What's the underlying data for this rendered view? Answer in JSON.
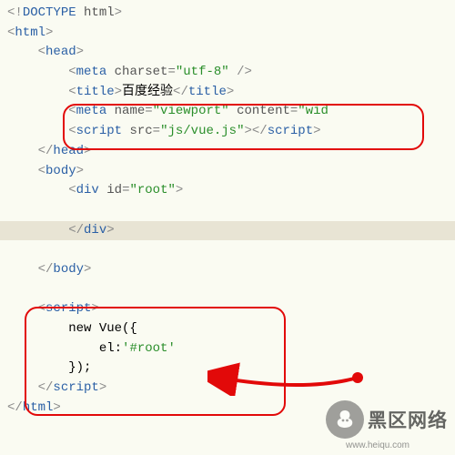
{
  "code": {
    "lines": [
      {
        "indent": 0,
        "tokens": [
          {
            "t": "punct",
            "v": "<!"
          },
          {
            "t": "tag",
            "v": "DOCTYPE"
          },
          {
            "t": "attr",
            "v": " html"
          },
          {
            "t": "punct",
            "v": ">"
          }
        ]
      },
      {
        "indent": 0,
        "tokens": [
          {
            "t": "punct",
            "v": "<"
          },
          {
            "t": "tag",
            "v": "html"
          },
          {
            "t": "punct",
            "v": ">"
          }
        ]
      },
      {
        "indent": 1,
        "tokens": [
          {
            "t": "punct",
            "v": "<"
          },
          {
            "t": "tag",
            "v": "head"
          },
          {
            "t": "punct",
            "v": ">"
          }
        ]
      },
      {
        "indent": 2,
        "tokens": [
          {
            "t": "punct",
            "v": "<"
          },
          {
            "t": "tag",
            "v": "meta"
          },
          {
            "t": "attr",
            "v": " charset"
          },
          {
            "t": "equals",
            "v": "="
          },
          {
            "t": "value",
            "v": "\"utf-8\""
          },
          {
            "t": "punct",
            "v": " />"
          }
        ]
      },
      {
        "indent": 2,
        "tokens": [
          {
            "t": "punct",
            "v": "<"
          },
          {
            "t": "tag",
            "v": "title"
          },
          {
            "t": "punct",
            "v": ">"
          },
          {
            "t": "text-content",
            "v": "百度经验"
          },
          {
            "t": "punct",
            "v": "</"
          },
          {
            "t": "tag",
            "v": "title"
          },
          {
            "t": "punct",
            "v": ">"
          }
        ]
      },
      {
        "indent": 2,
        "tokens": [
          {
            "t": "punct",
            "v": "<"
          },
          {
            "t": "tag",
            "v": "meta"
          },
          {
            "t": "attr",
            "v": " name"
          },
          {
            "t": "equals",
            "v": "="
          },
          {
            "t": "value",
            "v": "\"viewport\""
          },
          {
            "t": "attr",
            "v": " content"
          },
          {
            "t": "equals",
            "v": "="
          },
          {
            "t": "value",
            "v": "\"wid"
          }
        ]
      },
      {
        "indent": 2,
        "tokens": [
          {
            "t": "punct",
            "v": "<"
          },
          {
            "t": "tag",
            "v": "script"
          },
          {
            "t": "attr",
            "v": " src"
          },
          {
            "t": "equals",
            "v": "="
          },
          {
            "t": "value",
            "v": "\"js/vue.js\""
          },
          {
            "t": "punct",
            "v": "></"
          },
          {
            "t": "tag",
            "v": "script"
          },
          {
            "t": "punct",
            "v": ">"
          }
        ]
      },
      {
        "indent": 1,
        "tokens": [
          {
            "t": "punct",
            "v": "</"
          },
          {
            "t": "tag",
            "v": "head"
          },
          {
            "t": "punct",
            "v": ">"
          }
        ]
      },
      {
        "indent": 1,
        "tokens": [
          {
            "t": "punct",
            "v": "<"
          },
          {
            "t": "tag",
            "v": "body"
          },
          {
            "t": "punct",
            "v": ">"
          }
        ]
      },
      {
        "indent": 2,
        "tokens": [
          {
            "t": "punct",
            "v": "<"
          },
          {
            "t": "tag",
            "v": "div"
          },
          {
            "t": "attr",
            "v": " id"
          },
          {
            "t": "equals",
            "v": "="
          },
          {
            "t": "value",
            "v": "\"root\""
          },
          {
            "t": "punct",
            "v": ">"
          }
        ]
      },
      {
        "indent": 0,
        "tokens": []
      },
      {
        "indent": 2,
        "highlight": true,
        "tokens": [
          {
            "t": "punct",
            "v": "</"
          },
          {
            "t": "tag",
            "v": "div"
          },
          {
            "t": "punct",
            "v": ">"
          }
        ]
      },
      {
        "indent": 0,
        "tokens": []
      },
      {
        "indent": 1,
        "tokens": [
          {
            "t": "punct",
            "v": "</"
          },
          {
            "t": "tag",
            "v": "body"
          },
          {
            "t": "punct",
            "v": ">"
          }
        ]
      },
      {
        "indent": 0,
        "tokens": []
      },
      {
        "indent": 1,
        "tokens": [
          {
            "t": "punct",
            "v": "<"
          },
          {
            "t": "tag",
            "v": "script"
          },
          {
            "t": "punct",
            "v": ">"
          }
        ]
      },
      {
        "indent": 2,
        "tokens": [
          {
            "t": "text-content",
            "v": "new Vue({"
          }
        ]
      },
      {
        "indent": 3,
        "tokens": [
          {
            "t": "text-content",
            "v": "el:"
          },
          {
            "t": "value",
            "v": "'#root'"
          }
        ]
      },
      {
        "indent": 2,
        "tokens": [
          {
            "t": "text-content",
            "v": "});"
          }
        ]
      },
      {
        "indent": 1,
        "tokens": [
          {
            "t": "punct",
            "v": "</"
          },
          {
            "t": "tag",
            "v": "script"
          },
          {
            "t": "punct",
            "v": ">"
          }
        ]
      },
      {
        "indent": 0,
        "tokens": [
          {
            "t": "punct",
            "v": "</"
          },
          {
            "t": "tag",
            "v": "html"
          },
          {
            "t": "punct",
            "v": ">"
          }
        ]
      }
    ]
  },
  "indent_unit": "    ",
  "watermark": {
    "text": "黑区网络",
    "url": "www.heiqu.com"
  }
}
